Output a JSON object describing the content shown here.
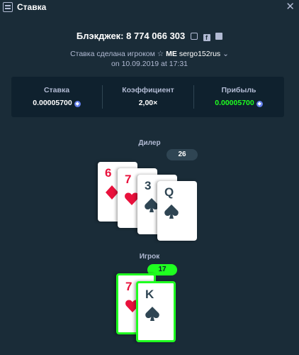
{
  "header": {
    "title": "Ставка",
    "icon": "receipt-icon",
    "close_icon": "close-icon"
  },
  "bet": {
    "game_line": "Блэкджек: 8 774 066 303",
    "placed_prefix": "Ставка сделана игроком",
    "user_badge": "ME",
    "username": "sergo152rus",
    "date": "on 10.09.2019 at 17:31"
  },
  "stats": {
    "bet_label": "Ставка",
    "bet_value": "0.00005700",
    "multiplier_label": "Коэффициент",
    "multiplier_value": "2,00×",
    "profit_label": "Прибыль",
    "profit_value": "0.00005700",
    "currency_icon": "ethereum-icon",
    "profit_color": "#1fff20"
  },
  "dealer": {
    "label": "Дилер",
    "score": "26",
    "cards": [
      {
        "rank": "6",
        "suit": "diamond"
      },
      {
        "rank": "7",
        "suit": "heart"
      },
      {
        "rank": "3",
        "suit": "spade"
      },
      {
        "rank": "Q",
        "suit": "spade"
      }
    ]
  },
  "player": {
    "label": "Игрок",
    "score": "17",
    "cards": [
      {
        "rank": "7",
        "suit": "heart"
      },
      {
        "rank": "K",
        "suit": "spade"
      }
    ]
  }
}
